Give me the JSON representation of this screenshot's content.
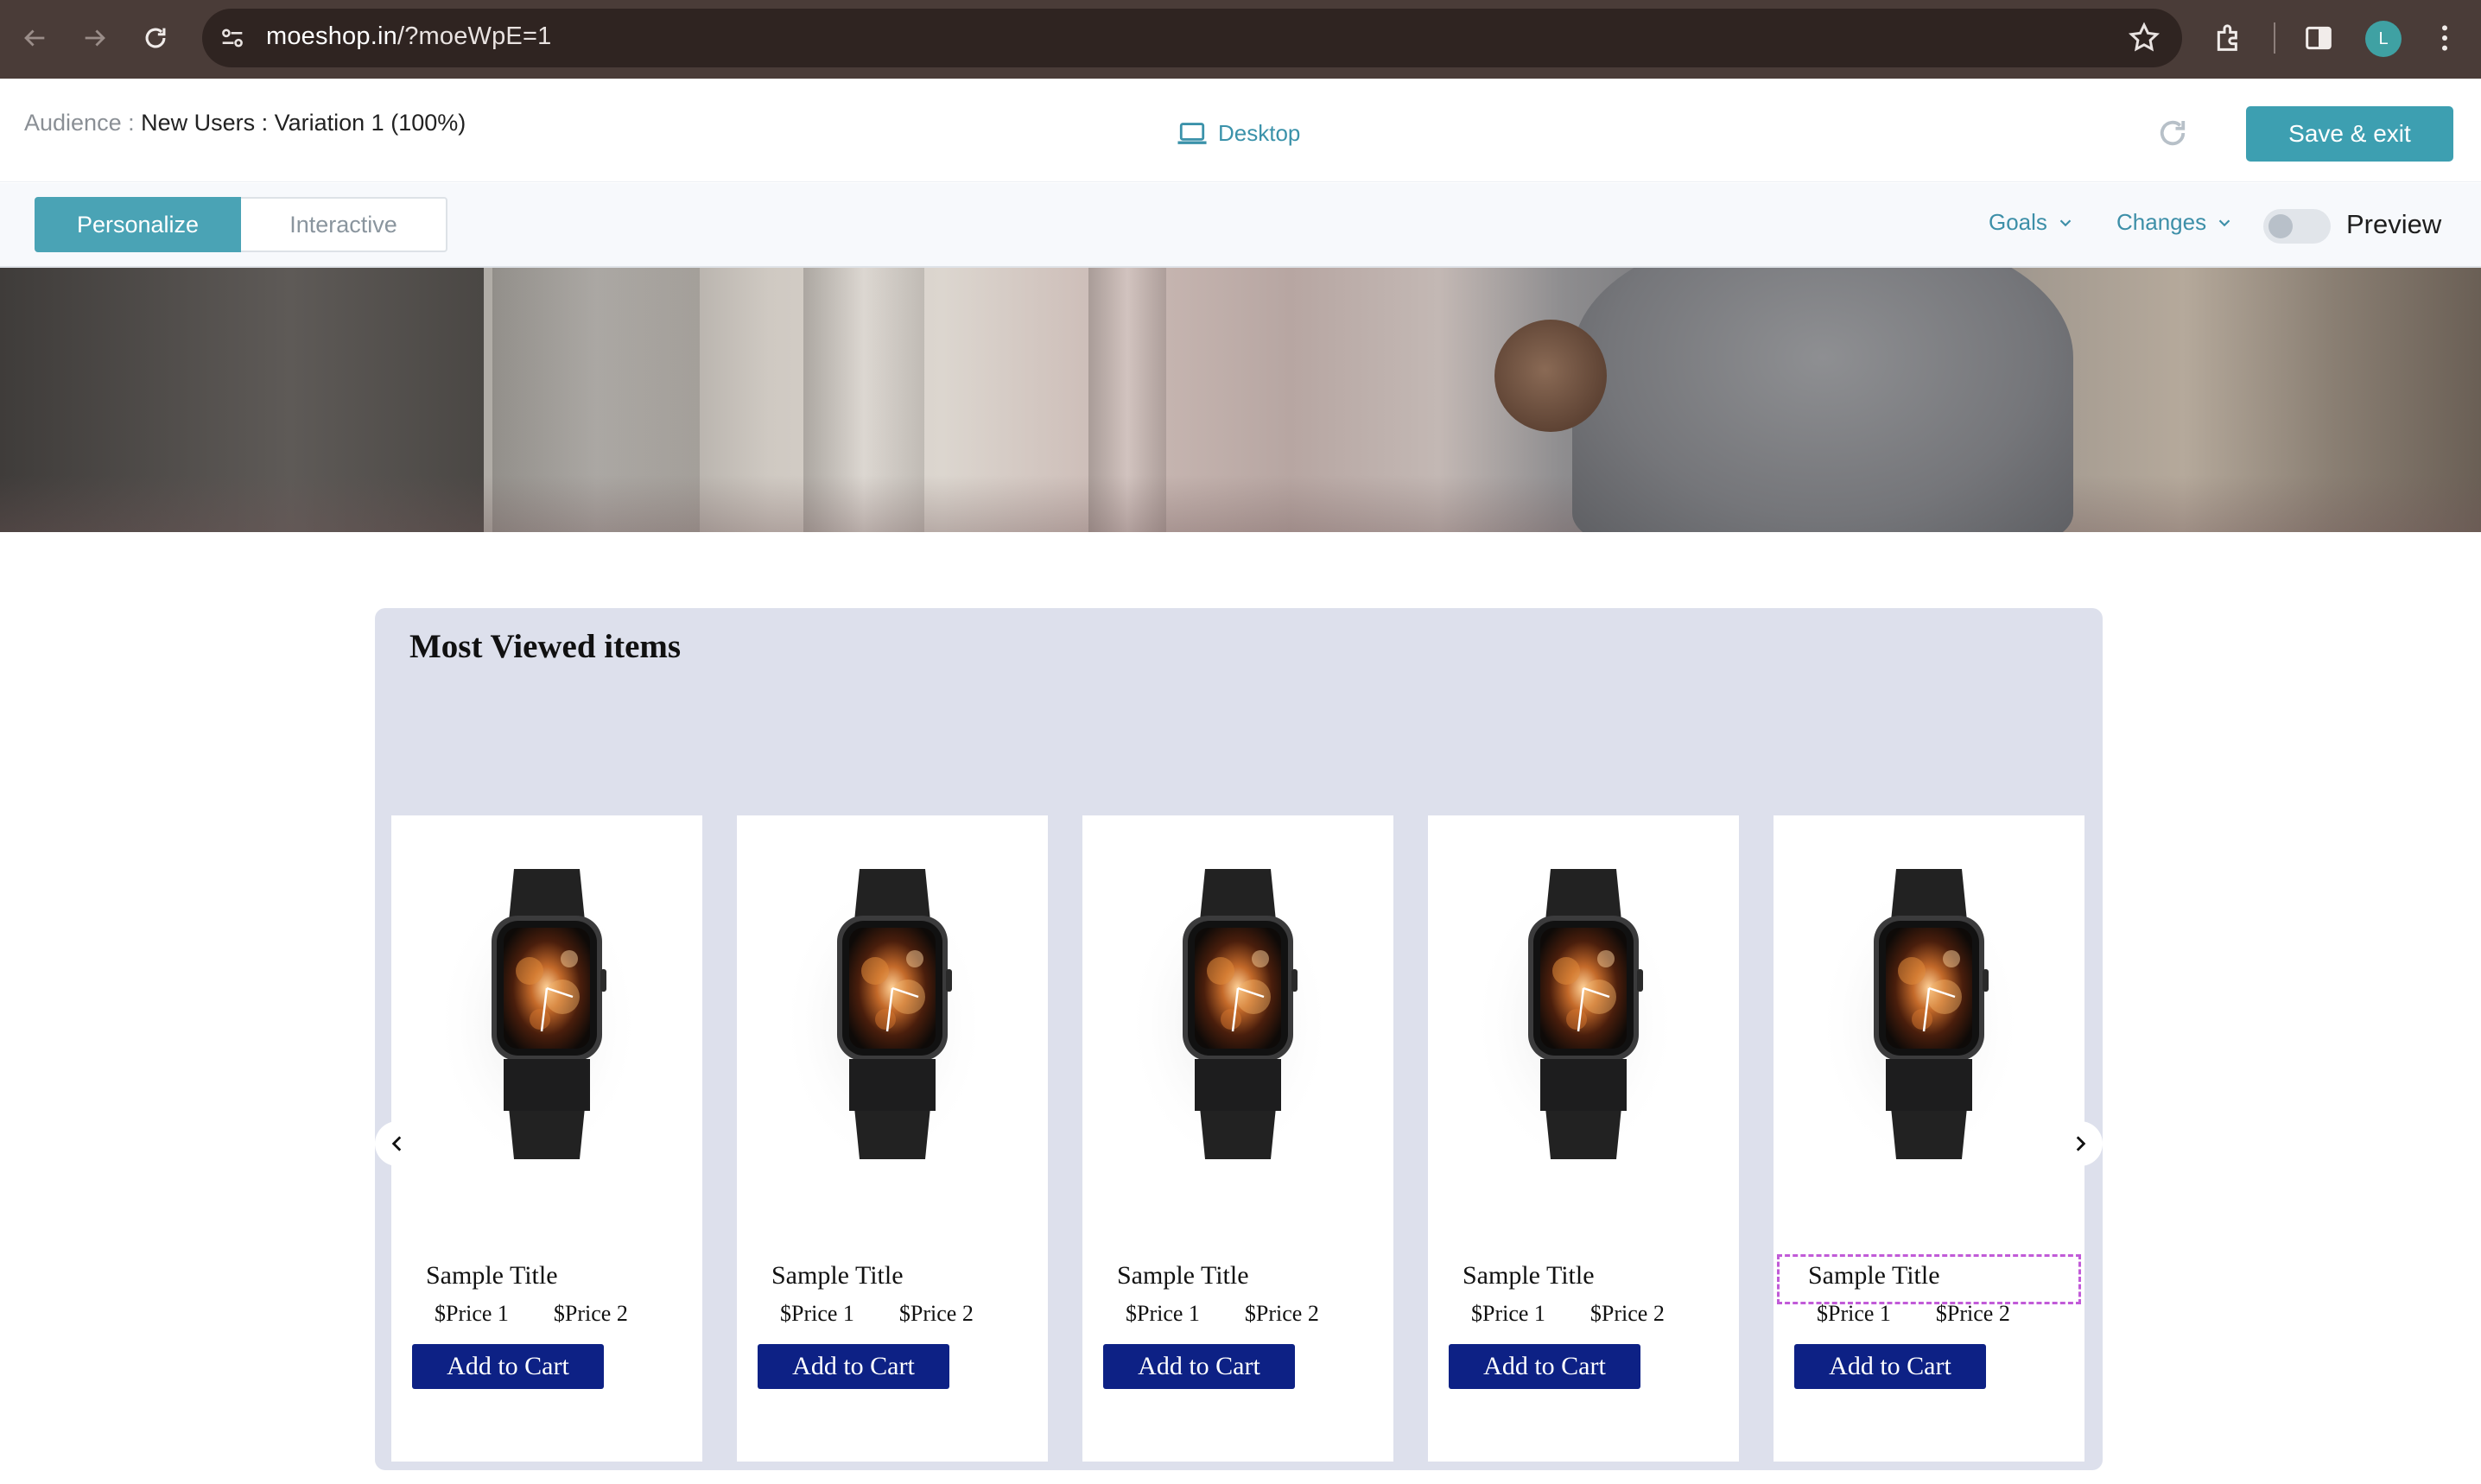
{
  "browser": {
    "url_host": "moeshop.in",
    "url_path": "/?moeWpE=1",
    "profile_initial": "L",
    "icons": [
      "back-arrow-icon",
      "forward-arrow-icon",
      "reload-icon",
      "site-settings-icon",
      "bookmark-star-icon",
      "extensions-icon",
      "side-panel-icon",
      "more-menu-icon"
    ]
  },
  "editor": {
    "audience_label": "Audience : ",
    "audience_value": "New Users : Variation 1 (100%)",
    "device_label": "Desktop",
    "save_label": "Save & exit",
    "tabs": [
      {
        "label": "Personalize",
        "active": true
      },
      {
        "label": "Interactive",
        "active": false
      }
    ],
    "goals_label": "Goals",
    "changes_label": "Changes",
    "preview_label": "Preview",
    "preview_on": false,
    "accent_color": "#3d9fb1"
  },
  "widget": {
    "title": "Most Viewed items",
    "background": "#dde0ec",
    "button_color": "#0d2185",
    "selected_outline_color": "#c15bd8",
    "products": [
      {
        "title": "Sample Title",
        "price1": "$Price 1",
        "price2": "$Price 2",
        "button": "Add to Cart",
        "selected": false
      },
      {
        "title": "Sample Title",
        "price1": "$Price 1",
        "price2": "$Price 2",
        "button": "Add to Cart",
        "selected": false
      },
      {
        "title": "Sample Title",
        "price1": "$Price 1",
        "price2": "$Price 2",
        "button": "Add to Cart",
        "selected": false
      },
      {
        "title": "Sample Title",
        "price1": "$Price 1",
        "price2": "$Price 2",
        "button": "Add to Cart",
        "selected": false
      },
      {
        "title": "Sample Title",
        "price1": "$Price 1",
        "price2": "$Price 2",
        "button": "Add to Cart",
        "selected": true
      }
    ]
  }
}
